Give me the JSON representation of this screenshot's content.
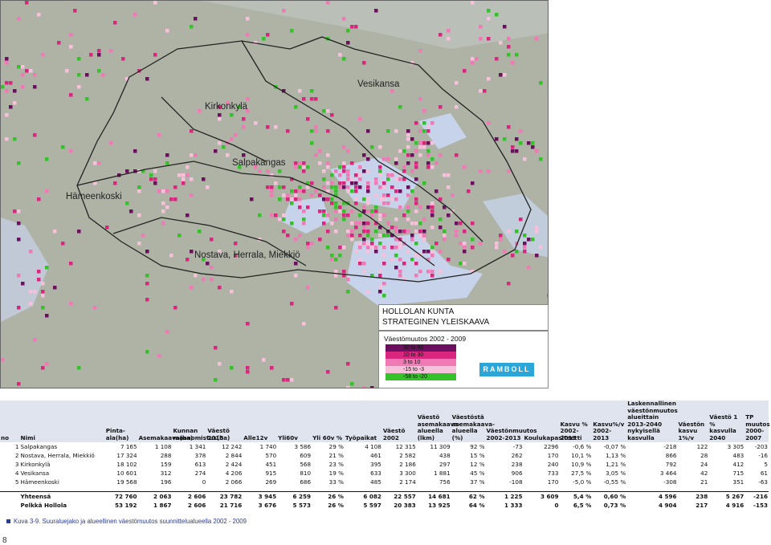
{
  "map": {
    "places": {
      "vesikansa": "Vesikansa",
      "kirkonkyla": "Kirkonkylä",
      "salpakangas": "Salpakangas",
      "hameenkoski": "Hämeenkoski",
      "nostava": "Nostava, Herrala, Miekkiö"
    },
    "title_line1": "HOLLOLAN KUNTA",
    "title_line2": "STRATEGINEN YLEISKAAVA",
    "legend": {
      "title": "Väestömuutos 2002 - 2009",
      "items": [
        {
          "label": "30 to  90",
          "color": "#6b0f5e"
        },
        {
          "label": "10 to  30",
          "color": "#d9267f"
        },
        {
          "label": "3 to  10",
          "color": "#f07ab5"
        },
        {
          "label": "-15 to  -3",
          "color": "#f7c1dc"
        },
        {
          "label": "-58 to -20",
          "color": "#35c12a"
        }
      ]
    },
    "logo_text": "RAMBOLL"
  },
  "table": {
    "headers": [
      "no",
      "Nimi",
      "Pinta-ala(ha)",
      "Asemakaava(ha)",
      "Kunnan maanomistus(ha)",
      "Väestö 2013",
      "Alle12v",
      "Yli60v",
      "Yli 60v %",
      "Työpaikat",
      "Väestö 2002",
      "Väestö asemakaava-alueella (lkm)",
      "Väestöstä asemakaava-alueella (%)",
      "Väestönmuutos 2002-2013",
      "Koulukapasiteetti",
      "Kasvu % 2002-2013",
      "Kasvu%/v 2002-2013",
      "Laskennallinen väestönmuutos alueittain 2013-2040 nykyisellä kasvulla",
      "Väestön kasvu 1%/v",
      "Väestö 1 % kasvulla 2040",
      "TP muutos 2000-2007"
    ],
    "rows": [
      [
        "1",
        "Salpakangas",
        "7 165",
        "1 108",
        "1 341",
        "12 242",
        "1 740",
        "3 586",
        "29 %",
        "4 108",
        "12 315",
        "11 309",
        "92 %",
        "-73",
        "2296",
        "-0,6 %",
        "-0,07 %",
        "-218",
        "122",
        "3 305",
        "-203"
      ],
      [
        "2",
        "Nostava, Herrala, Miekkiö",
        "17 324",
        "288",
        "378",
        "2 844",
        "570",
        "609",
        "21 %",
        "461",
        "2 582",
        "438",
        "15 %",
        "262",
        "170",
        "10,1 %",
        "1,13 %",
        "866",
        "28",
        "483",
        "-16"
      ],
      [
        "3",
        "Kirkonkylä",
        "18 102",
        "159",
        "613",
        "2 424",
        "451",
        "568",
        "23 %",
        "395",
        "2 186",
        "297",
        "12 %",
        "238",
        "240",
        "10,9 %",
        "1,21 %",
        "792",
        "24",
        "412",
        "5"
      ],
      [
        "4",
        "Vesikansa",
        "10 601",
        "312",
        "274",
        "4 206",
        "915",
        "810",
        "19 %",
        "633",
        "3 300",
        "1 881",
        "45 %",
        "906",
        "733",
        "27,5 %",
        "3,05 %",
        "3 464",
        "42",
        "715",
        "61"
      ],
      [
        "5",
        "Hämeenkoski",
        "19 568",
        "196",
        "0",
        "2 066",
        "269",
        "686",
        "33 %",
        "485",
        "2 174",
        "756",
        "37 %",
        "-108",
        "170",
        "-5,0 %",
        "-0,55 %",
        "-308",
        "21",
        "351",
        "-63"
      ]
    ],
    "totals": [
      [
        "",
        "Yhteensä",
        "72 760",
        "2 063",
        "2 606",
        "23 782",
        "3 945",
        "6 259",
        "26 %",
        "6 082",
        "22 557",
        "14 681",
        "62 %",
        "1 225",
        "3 609",
        "5,4 %",
        "0,60 %",
        "4 596",
        "238",
        "5 267",
        "-216"
      ],
      [
        "",
        "Pelkkä Hollola",
        "53 192",
        "1 867",
        "2 606",
        "21 716",
        "3 676",
        "5 573",
        "26 %",
        "5 597",
        "20 383",
        "13 925",
        "64 %",
        "1 333",
        "0",
        "6,5 %",
        "0,73 %",
        "4 904",
        "217",
        "4 916",
        "-153"
      ]
    ]
  },
  "caption": "Kuva 3-9. Suuraluejako ja alueellinen väestömuutos suunnittelualueella 2002 - 2009",
  "page_number": "8"
}
